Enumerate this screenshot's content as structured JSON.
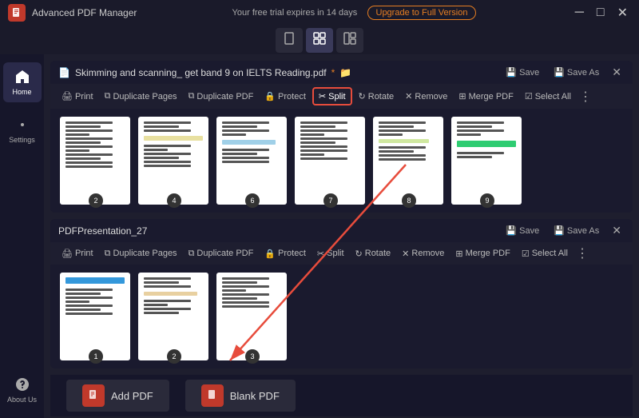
{
  "app": {
    "title": "Advanced PDF Manager",
    "trial_notice": "Your free trial expires in 14 days",
    "upgrade_btn": "Upgrade to Full Version"
  },
  "win_controls": {
    "minimize": "─",
    "maximize": "□",
    "close": "✕"
  },
  "view_toolbar": {
    "btns": [
      "⊡",
      "⊞",
      "⊟"
    ]
  },
  "sidebar": {
    "items": [
      {
        "label": "Home",
        "icon": "home"
      },
      {
        "label": "Settings",
        "icon": "settings"
      },
      {
        "label": "About Us",
        "icon": "info"
      }
    ],
    "active": 0
  },
  "pdf1": {
    "title": "Skimming and scanning_ get band 9 on IELTS Reading.pdf",
    "unsaved": "*",
    "save": "Save",
    "save_as": "Save As",
    "toolbar": {
      "print": "Print",
      "duplicate_pages": "Duplicate Pages",
      "duplicate_pdf": "Duplicate PDF",
      "protect": "Protect",
      "split": "Split",
      "rotate": "Rotate",
      "remove": "Remove",
      "merge_pdf": "Merge PDF",
      "select_all": "Select All"
    },
    "pages": [
      {
        "num": "2"
      },
      {
        "num": "4"
      },
      {
        "num": "6"
      },
      {
        "num": "7"
      },
      {
        "num": "8"
      },
      {
        "num": "9"
      }
    ]
  },
  "pdf2": {
    "title": "PDFPresentation_27",
    "save": "Save",
    "save_as": "Save As",
    "toolbar": {
      "print": "Print",
      "duplicate_pages": "Duplicate Pages",
      "duplicate_pdf": "Duplicate PDF",
      "protect": "Protect",
      "split": "Split",
      "rotate": "Rotate",
      "remove": "Remove",
      "merge_pdf": "Merge PDF",
      "select_all": "Select All"
    },
    "pages": [
      {
        "num": "1"
      },
      {
        "num": "2"
      },
      {
        "num": "3"
      }
    ]
  },
  "bottom": {
    "add_pdf": "Add PDF",
    "blank_pdf": "Blank PDF"
  }
}
